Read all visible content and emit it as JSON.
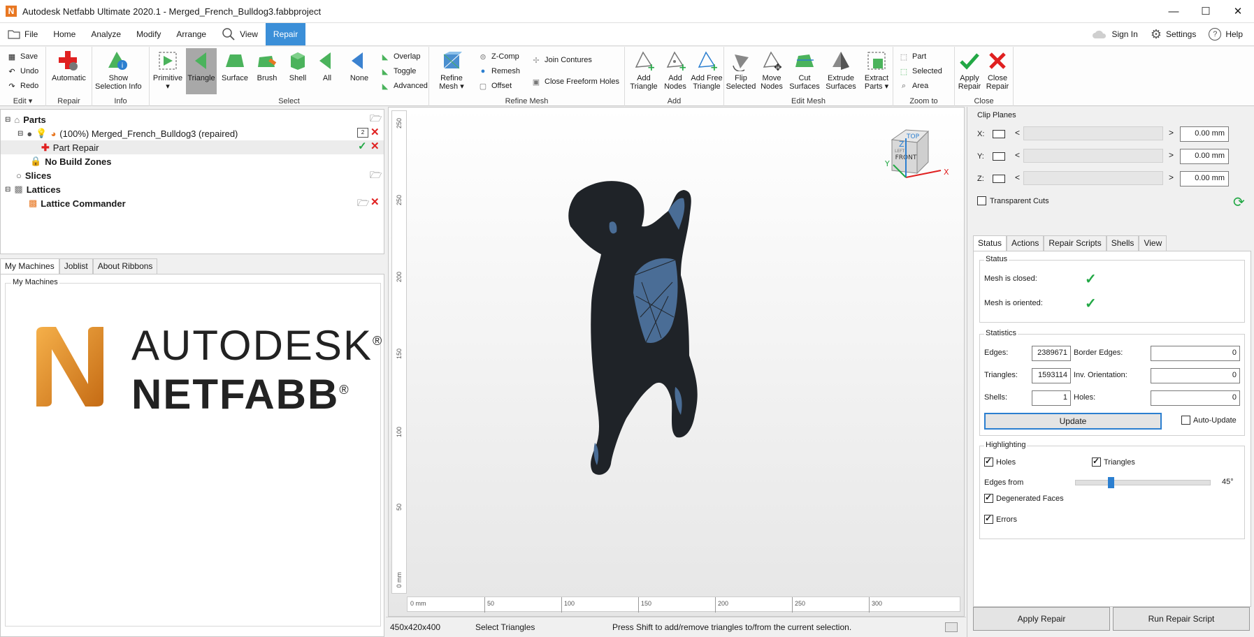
{
  "window": {
    "title": "Autodesk Netfabb Ultimate 2020.1 - Merged_French_Bulldog3.fabbproject",
    "logo_letter": "N"
  },
  "menu": {
    "file": "File",
    "home": "Home",
    "analyze": "Analyze",
    "modify": "Modify",
    "arrange": "Arrange",
    "view": "View",
    "repair": "Repair",
    "sign_in": "Sign In",
    "settings": "Settings",
    "help": "Help"
  },
  "ribbon": {
    "edit": {
      "save": "Save",
      "undo": "Undo",
      "redo": "Redo",
      "label": "Edit"
    },
    "repair": {
      "automatic": "Automatic",
      "label": "Repair"
    },
    "info": {
      "show_selection_1": "Show",
      "show_selection_2": "Selection Info",
      "label": "Info"
    },
    "select": {
      "primitive": "Primitive",
      "triangle": "Triangle",
      "surface": "Surface",
      "brush": "Brush",
      "shell": "Shell",
      "all": "All",
      "none": "None",
      "overlap": "Overlap",
      "toggle": "Toggle",
      "advanced": "Advanced",
      "label": "Select"
    },
    "refine": {
      "refine_1": "Refine",
      "refine_2": "Mesh",
      "zcomp": "Z-Comp",
      "remesh": "Remesh",
      "offset": "Offset",
      "join": "Join Contures",
      "close_freeform": "Close Freeform Holes",
      "label": "Refine Mesh"
    },
    "add": {
      "add_tri_1": "Add",
      "add_tri_2": "Triangle",
      "add_nodes_1": "Add",
      "add_nodes_2": "Nodes",
      "add_free_1": "Add Free",
      "add_free_2": "Triangle",
      "label": "Add"
    },
    "editmesh": {
      "flip_1": "Flip",
      "flip_2": "Selected",
      "move_1": "Move",
      "move_2": "Nodes",
      "cut_1": "Cut",
      "cut_2": "Surfaces",
      "extrude_1": "Extrude",
      "extrude_2": "Surfaces",
      "extract_1": "Extract",
      "extract_2": "Parts",
      "label": "Edit Mesh"
    },
    "zoom": {
      "part": "Part",
      "selected": "Selected",
      "area": "Area",
      "label": "Zoom to"
    },
    "close": {
      "apply_1": "Apply",
      "apply_2": "Repair",
      "close_1": "Close",
      "close_2": "Repair",
      "label": "Close"
    }
  },
  "tree": {
    "parts": "Parts",
    "part_name": "(100%) Merged_French_Bulldog3 (repaired)",
    "part_badge": "2",
    "part_repair": "Part Repair",
    "no_build": "No Build Zones",
    "slices": "Slices",
    "lattices": "Lattices",
    "lattice_commander": "Lattice Commander"
  },
  "left_tabs": [
    "My Machines",
    "Joblist",
    "About Ribbons"
  ],
  "machines": {
    "group_label": "My Machines",
    "brand_1": "AUTODESK",
    "brand_2": "NETFABB",
    "reg": "®"
  },
  "viewport": {
    "y_ticks": [
      "250",
      "200",
      "150",
      "100",
      "50",
      "0 mm"
    ],
    "x_ticks": [
      "0 mm",
      "50",
      "100",
      "150",
      "200",
      "250",
      "300"
    ],
    "cube": {
      "top": "TOP",
      "front": "FRONT",
      "left": "LEFT",
      "axis_x": "X",
      "axis_y": "Y",
      "axis_z": "Z"
    }
  },
  "statusbar": {
    "size": "450x420x400",
    "mode": "Select Triangles",
    "hint": "Press Shift to add/remove triangles to/from the current selection."
  },
  "clip": {
    "title": "Clip Planes",
    "x_label": "X:",
    "y_label": "Y:",
    "z_label": "Z:",
    "x_val": "0.00 mm",
    "y_val": "0.00 mm",
    "z_val": "0.00 mm",
    "transparent": "Transparent Cuts"
  },
  "right_tabs": [
    "Status",
    "Actions",
    "Repair Scripts",
    "Shells",
    "View"
  ],
  "status": {
    "group": "Status",
    "closed": "Mesh is closed:",
    "oriented": "Mesh is oriented:"
  },
  "stats": {
    "group": "Statistics",
    "edges_label": "Edges:",
    "edges": "2389671",
    "triangles_label": "Triangles:",
    "triangles": "1593114",
    "shells_label": "Shells:",
    "shells": "1",
    "border_label": "Border Edges:",
    "border": "0",
    "inv_label": "Inv. Orientation:",
    "inv": "0",
    "holes_label": "Holes:",
    "holes": "0",
    "update": "Update",
    "auto_update": "Auto-Update"
  },
  "highlight": {
    "group": "Highlighting",
    "holes": "Holes",
    "triangles": "Triangles",
    "edges_from": "Edges from",
    "edges_deg": "45°",
    "edges_level": 0.25,
    "degenerated": "Degenerated Faces",
    "errors": "Errors"
  },
  "bottom_buttons": {
    "apply": "Apply Repair",
    "run_script": "Run Repair Script"
  },
  "colors": {
    "accent": "#3b8fd8",
    "green": "#22a845",
    "red": "#e02020",
    "mesh_dark": "#1f2328",
    "mesh_blue": "#4a6d96"
  }
}
